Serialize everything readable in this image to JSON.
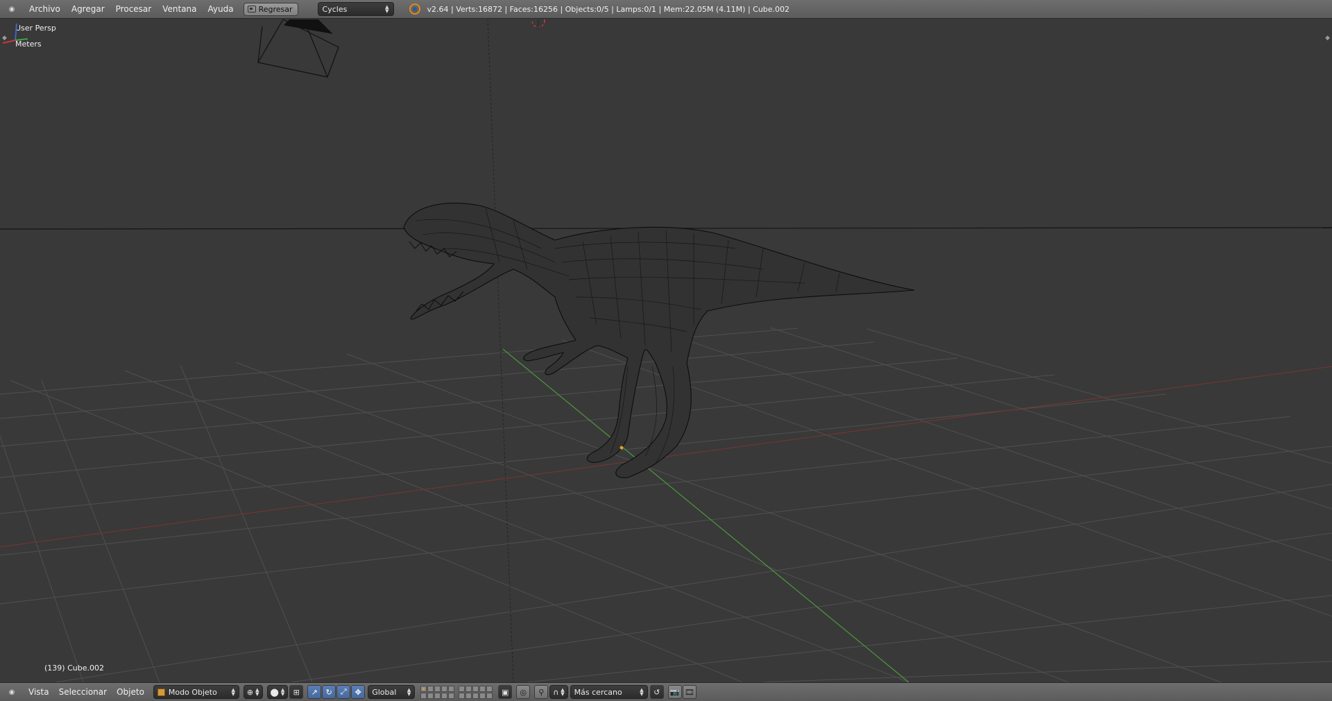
{
  "top_header": {
    "menus": [
      "Archivo",
      "Agregar",
      "Procesar",
      "Ventana",
      "Ayuda"
    ],
    "back_button": "Regresar",
    "render_engine": "Cycles",
    "stats": "v2.64 | Verts:16872 | Faces:16256 | Objects:0/5 | Lamps:0/1 | Mem:22.05M (4.11M) | Cube.002"
  },
  "viewport": {
    "view_name": "User Persp",
    "units": "Meters",
    "object_info": "(139) Cube.002",
    "colors": {
      "background": "#393939",
      "grid": "#4f4f4f",
      "x_axis": "#8a3a3a",
      "y_axis": "#4c9a3c",
      "horizon": "#111111",
      "wireframe": "#0c0c0c"
    },
    "icons": [
      "camera-icon",
      "cursor-3d-icon",
      "axis-gizmo-icon"
    ]
  },
  "bottom_header": {
    "menus": [
      "Vista",
      "Seleccionar",
      "Objeto"
    ],
    "mode": "Modo Objeto",
    "orientation": "Global",
    "snap_target": "Más cercano"
  }
}
